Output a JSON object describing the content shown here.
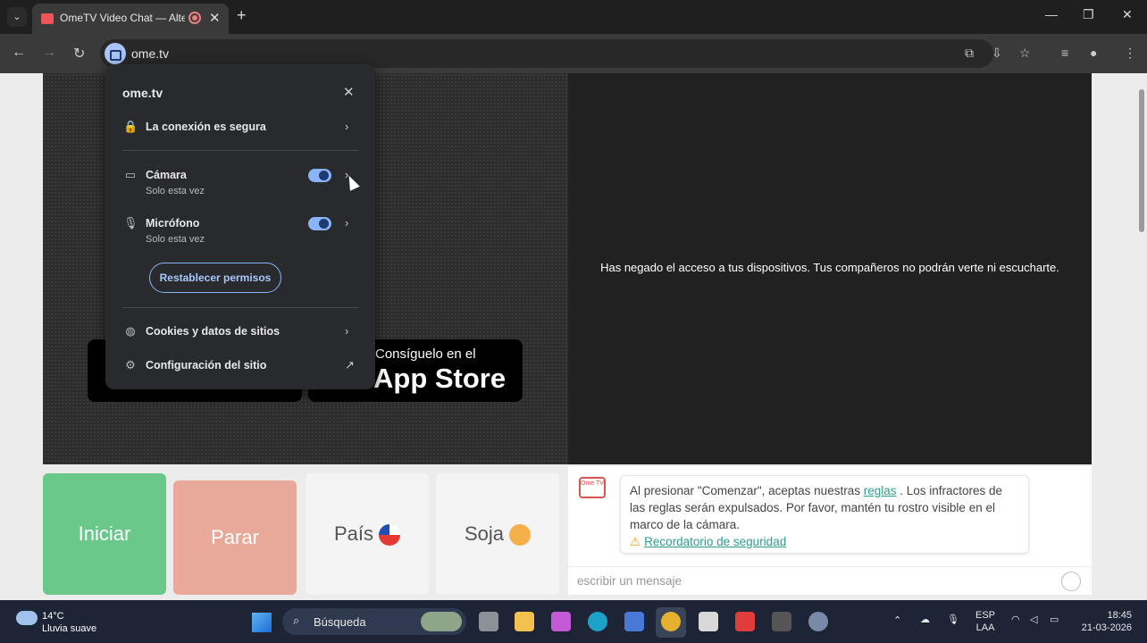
{
  "browser": {
    "tab_title": "OmeTV Video Chat — Alternati",
    "url": "ome.tv"
  },
  "popup": {
    "site": "ome.tv",
    "connection": "La conexión es segura",
    "camera_label": "Cámara",
    "camera_sub": "Solo esta vez",
    "mic_label": "Micrófono",
    "mic_sub": "Solo esta vez",
    "reset_label": "Restablecer permisos",
    "cookies_label": "Cookies y datos de sitios",
    "site_settings_label": "Configuración del sitio"
  },
  "video": {
    "denied_text": "Has negado el acceso a tus dispositivos. Tus compañeros no podrán verte ni escucharte.",
    "appstore_line1": "Consíguelo en el",
    "appstore_line2": "App Store"
  },
  "controls": {
    "start": "Iniciar",
    "stop": "Parar",
    "country": "País",
    "gender": "Soja"
  },
  "chat": {
    "logo_text": "Ome TV",
    "msg_part1": "Al presionar \"Comenzar\", aceptas nuestras ",
    "rules_link": "reglas",
    "msg_part2": " . Los infractores de las reglas serán expulsados. Por favor, mantén tu rostro visible en el marco de la cámara.",
    "safety_link": "Recordatorio de seguridad",
    "input_placeholder": "escribir un mensaje"
  },
  "taskbar": {
    "temp": "14°C",
    "weather_desc": "Lluvia suave",
    "search_label": "Búsqueda",
    "lang1": "ESP",
    "lang2": "LAA",
    "time": "18:45",
    "date": "21-03-2026"
  }
}
